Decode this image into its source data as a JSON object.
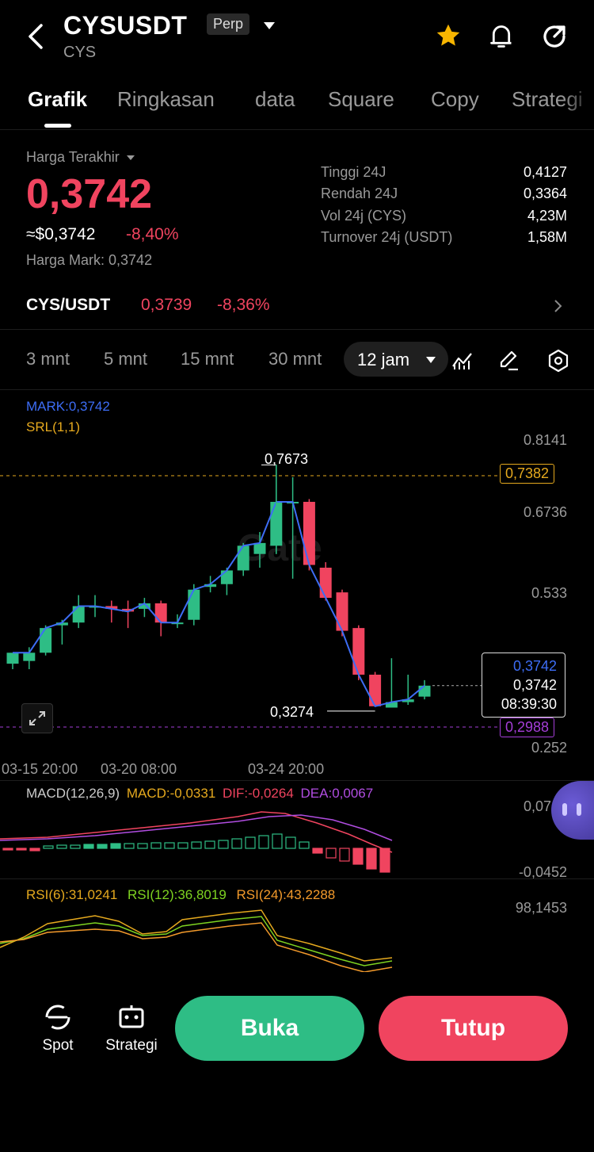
{
  "header": {
    "symbol": "CYSUSDT",
    "badge": "Perp",
    "subtitle": "CYS",
    "icons": [
      "back-icon",
      "star-icon",
      "bell-icon",
      "share-icon"
    ]
  },
  "tabs": [
    "Grafik",
    "Ringkasan",
    "data",
    "Square",
    "Copy",
    "Strategi"
  ],
  "price": {
    "label": "Harga Terakhir",
    "last": "0,3742",
    "usd": "≈$0,3742",
    "change": "-8,40%",
    "mark": "Harga Mark: 0,3742",
    "stats": [
      {
        "label": "Tinggi 24J",
        "value": "0,4127"
      },
      {
        "label": "Rendah 24J",
        "value": "0,3364"
      },
      {
        "label": "Vol 24j (CYS)",
        "value": "4,23M"
      },
      {
        "label": "Turnover 24j (USDT)",
        "value": "1,58M"
      }
    ]
  },
  "spot_pair": {
    "name": "CYS/USDT",
    "price": "0,3739",
    "change": "-8,36%"
  },
  "timeframes": [
    "3 mnt",
    "5 mnt",
    "15 mnt",
    "30 mnt",
    "12 jam"
  ],
  "indicators": {
    "mark": "MARK:0,3742",
    "srl": "SRL(1,1)"
  },
  "chart_labels": {
    "high_label": "0,7673",
    "low_label": "0,3274",
    "srl_top": "0,7382",
    "srl_bottom": "0,2988",
    "current_mark": "0,3742",
    "current_last": "0,3742",
    "countdown": "08:39:30",
    "watermark": "Gate"
  },
  "macd": {
    "title": "MACD(12,26,9)",
    "macd": "MACD:-0,0331",
    "dif": "DIF:-0,0264",
    "dea": "DEA:0,0067",
    "axis_top": "0,0716",
    "axis_bottom": "-0,0452"
  },
  "rsi": {
    "r6": "RSI(6):31,0241",
    "r12": "RSI(12):36,8019",
    "r24": "RSI(24):43,2288",
    "axis_top": "98,1453"
  },
  "bottom": {
    "spot": "Spot",
    "strategi": "Strategi",
    "buka": "Buka",
    "tutup": "Tutup"
  },
  "colors": {
    "up": "#2ebd85",
    "down": "#f0445f",
    "mark_line": "#3d6df5",
    "srl": "#e5a91e",
    "srl_low": "#a53ed8"
  },
  "chart_data": {
    "type": "candlestick",
    "x_ticks": [
      "03-15 20:00",
      "03-20 08:00",
      "03-24 20:00"
    ],
    "y_ticks": [
      0.8141,
      0.6736,
      0.533,
      0.252
    ],
    "ylim": [
      0.252,
      0.8141
    ],
    "candles": [
      {
        "o": 0.405,
        "h": 0.42,
        "c": 0.425,
        "l": 0.395
      },
      {
        "o": 0.41,
        "h": 0.435,
        "c": 0.425,
        "l": 0.395
      },
      {
        "o": 0.425,
        "h": 0.475,
        "c": 0.47,
        "l": 0.42
      },
      {
        "o": 0.475,
        "h": 0.485,
        "c": 0.48,
        "l": 0.44
      },
      {
        "o": 0.48,
        "h": 0.53,
        "c": 0.51,
        "l": 0.47
      },
      {
        "o": 0.51,
        "h": 0.53,
        "c": 0.51,
        "l": 0.49
      },
      {
        "o": 0.51,
        "h": 0.52,
        "c": 0.505,
        "l": 0.48
      },
      {
        "o": 0.505,
        "h": 0.52,
        "c": 0.5,
        "l": 0.47
      },
      {
        "o": 0.505,
        "h": 0.525,
        "c": 0.515,
        "l": 0.49
      },
      {
        "o": 0.515,
        "h": 0.52,
        "c": 0.48,
        "l": 0.455
      },
      {
        "o": 0.48,
        "h": 0.495,
        "c": 0.48,
        "l": 0.47
      },
      {
        "o": 0.485,
        "h": 0.55,
        "c": 0.54,
        "l": 0.475
      },
      {
        "o": 0.545,
        "h": 0.565,
        "c": 0.55,
        "l": 0.535
      },
      {
        "o": 0.55,
        "h": 0.58,
        "c": 0.575,
        "l": 0.53
      },
      {
        "o": 0.575,
        "h": 0.625,
        "c": 0.62,
        "l": 0.565
      },
      {
        "o": 0.605,
        "h": 0.645,
        "c": 0.625,
        "l": 0.58
      },
      {
        "o": 0.62,
        "h": 0.7673,
        "c": 0.7,
        "l": 0.605
      },
      {
        "o": 0.7,
        "h": 0.745,
        "c": 0.7,
        "l": 0.56
      },
      {
        "o": 0.7,
        "h": 0.705,
        "c": 0.585,
        "l": 0.575
      },
      {
        "o": 0.58,
        "h": 0.59,
        "c": 0.525,
        "l": 0.52
      },
      {
        "o": 0.535,
        "h": 0.54,
        "c": 0.465,
        "l": 0.455
      },
      {
        "o": 0.47,
        "h": 0.475,
        "c": 0.385,
        "l": 0.375
      },
      {
        "o": 0.385,
        "h": 0.39,
        "c": 0.3274,
        "l": 0.3274
      },
      {
        "o": 0.325,
        "h": 0.415,
        "c": 0.335,
        "l": 0.325
      },
      {
        "o": 0.335,
        "h": 0.385,
        "c": 0.34,
        "l": 0.33
      },
      {
        "o": 0.345,
        "h": 0.375,
        "c": 0.365,
        "l": 0.34
      }
    ]
  }
}
